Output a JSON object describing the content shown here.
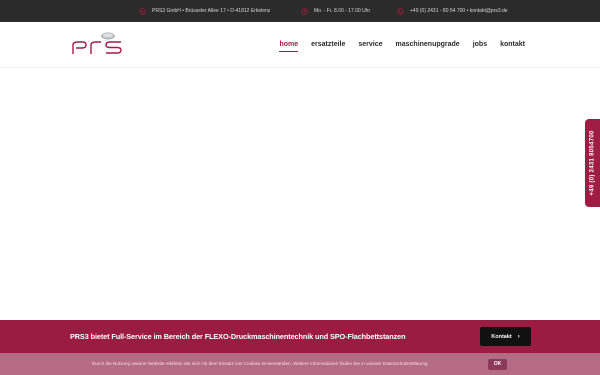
{
  "topbar": {
    "address": "PRS3 GmbH • Brüsseler Allee 17 • D-41812 Erkelenz",
    "hours": "Mo. - Fr. 8.00 - 17.00 Uhr",
    "contact": "+49 (0) 2431 - 80 54 700 • kontakt@prs3.de",
    "icon_color": "#a51a43"
  },
  "header": {
    "logo_icon": "prs-logo",
    "nav": [
      {
        "label": "home",
        "active": true
      },
      {
        "label": "ersatzteile",
        "active": false
      },
      {
        "label": "service",
        "active": false
      },
      {
        "label": "maschinenupgrade",
        "active": false
      },
      {
        "label": "jobs",
        "active": false
      },
      {
        "label": "kontakt",
        "active": false
      }
    ]
  },
  "side_tab": {
    "phone": "+49 (0) 2431 8054700"
  },
  "cta": {
    "text": "PRS3 bietet Full-Service im Bereich der FLEXO-Druckmaschinentechnik und SPO-Flachbettstanzen",
    "button_label": "Kontakt",
    "button_icon": "chevron-right-icon",
    "color": "#9b1c42"
  },
  "cookie": {
    "text": "Durch die Nutzung unserer Website erklären Sie sich mit dem Einsatz von Cookies einverstanden. Weitere Informationen finden Sie in unserer Datenschutzerklärung.",
    "ok_label": "OK"
  }
}
